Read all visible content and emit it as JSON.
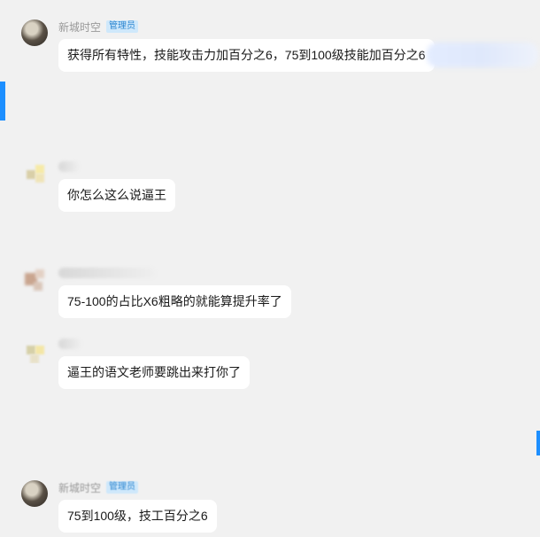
{
  "messages": [
    {
      "nickname": "新城时空",
      "badge": "管理员",
      "text": "获得所有特性，技能攻击力加百分之6，75到100级技能加百分之6"
    },
    {
      "nickname": "",
      "badge": "",
      "text": "你怎么这么说逼王"
    },
    {
      "nickname": "",
      "badge": "",
      "text": "75-100的占比X6粗略的就能算提升率了"
    },
    {
      "nickname": "",
      "badge": "",
      "text": "逼王的语文老师要跳出来打你了"
    },
    {
      "nickname": "新城时空",
      "badge": "管理员",
      "text": "75到100级，技工百分之6"
    }
  ],
  "colors": {
    "accent": "#1d8fff",
    "badge_bg": "#cfe8fb",
    "badge_text": "#2c86d0",
    "bubble_bg": "#ffffff",
    "chat_bg": "#f1f1f1"
  }
}
